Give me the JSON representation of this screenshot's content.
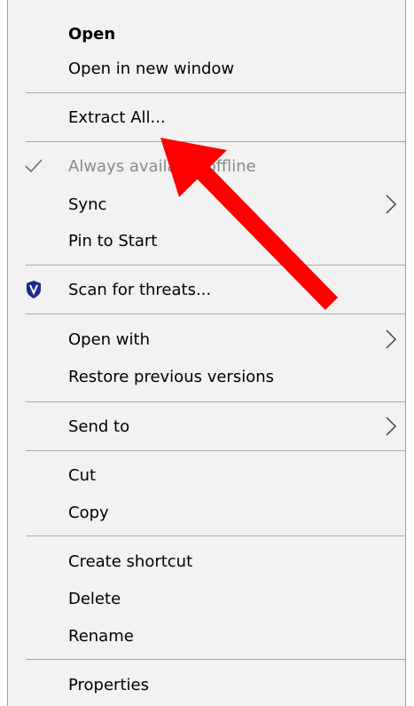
{
  "menu": {
    "items": {
      "open": "Open",
      "open_new_window": "Open in new window",
      "extract_all": "Extract All...",
      "always_available_offline": "Always available offline",
      "sync": "Sync",
      "pin_to_start": "Pin to Start",
      "scan_for_threats": "Scan for threats...",
      "open_with": "Open with",
      "restore_previous_versions": "Restore previous versions",
      "send_to": "Send to",
      "cut": "Cut",
      "copy": "Copy",
      "create_shortcut": "Create shortcut",
      "delete": "Delete",
      "rename": "Rename",
      "properties": "Properties"
    },
    "icons": {
      "checkmark": "checkmark-icon",
      "shield": "defender-shield-icon",
      "submenu": "chevron-right-icon"
    }
  },
  "colors": {
    "menu_background": "#f2f2f2",
    "disabled_text": "#8a8a8a",
    "annotation_arrow": "#ff0000"
  }
}
